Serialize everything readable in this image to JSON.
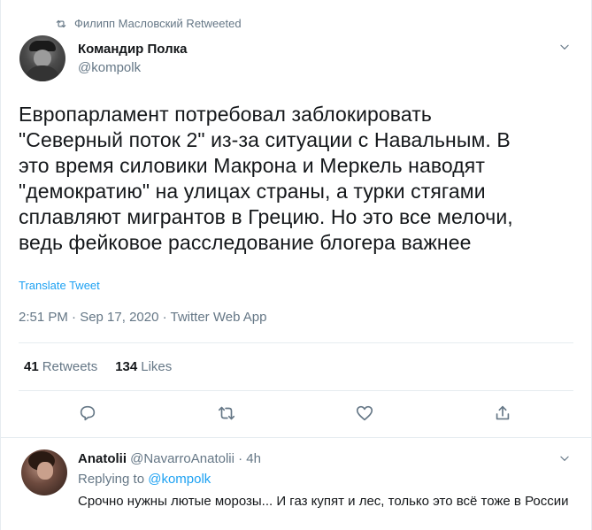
{
  "retweet": {
    "label": "Филипп Масловский Retweeted",
    "icon": "retweet-icon"
  },
  "tweet": {
    "author_name": "Командир Полка",
    "author_handle": "@kompolk",
    "text_lines": [
      "Европарламент потребовал заблокировать",
      "\"Северный поток 2\" из-за ситуации с Навальным. В",
      "это время силовики Макрона и Меркель наводят",
      "\"демократию\" на улицах страны, а турки стягами",
      "сплавляют мигрантов в Грецию. Но это все мелочи,",
      "ведь фейковое расследование блогера важнее"
    ],
    "translate_label": "Translate Tweet",
    "meta": "2:51 PM · Sep 17, 2020 · Twitter Web App",
    "retweets_count": "41",
    "retweets_label": "Retweets",
    "likes_count": "134",
    "likes_label": "Likes"
  },
  "actions": [
    "reply-icon",
    "retweet-icon",
    "like-icon",
    "share-icon"
  ],
  "reply": {
    "author_name": "Anatolii",
    "author_handle": "@NavarroAnatolii",
    "time": "· 4h",
    "replying_prefix": "Replying to",
    "replying_to": "@kompolk",
    "text": "Срочно нужны лютые морозы... И газ купят и лес, только это всё тоже в России"
  },
  "colors": {
    "accent": "#1da1f2",
    "secondary_text": "#657786",
    "primary_text": "#14171a",
    "divider": "#e6ecf0"
  }
}
